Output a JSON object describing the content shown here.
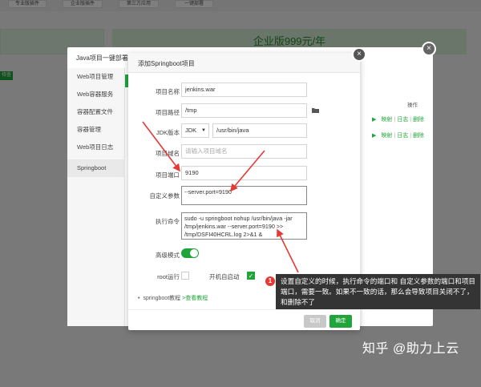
{
  "background": {
    "tabs": [
      "专业版插件",
      "企业版插件",
      "第三方应用",
      "一键部署"
    ],
    "price_banner": "企业版999元/年",
    "badge": "待查"
  },
  "back_modal": {
    "title": "Java项目一键部署",
    "nav": [
      "Web项目管理",
      "Web容器服务",
      "容器配置文件",
      "容器管理",
      "Web项目日志",
      "Springboot"
    ],
    "table_header": "操作",
    "rows": [
      {
        "play": "▶",
        "a": "映射",
        "b": "日志",
        "c": "删除"
      },
      {
        "play": "▶",
        "a": "映射",
        "b": "日志",
        "c": "删除"
      }
    ]
  },
  "dialog": {
    "title": "添加Springboot项目",
    "close_glyph": "×",
    "fields": {
      "project_name": {
        "label": "项目名称",
        "value": "jenkins.war"
      },
      "project_path": {
        "label": "项目路径",
        "value": "/tmp"
      },
      "jdk": {
        "label": "JDK版本",
        "select": "JDK",
        "value": "/usr/bin/java"
      },
      "project_domain": {
        "label": "项目域名",
        "placeholder": "请输入项目域名"
      },
      "project_port": {
        "label": "项目端口",
        "value": "9190"
      },
      "custom_params": {
        "label": "自定义参数",
        "value": "--server.port=9190"
      },
      "exec_command": {
        "label": "执行命令",
        "value": "sudo -u springboot nohup /usr/bin/java -jar /tmp/jenkins.war --server.port=9190 >> /tmp/DSFI40HCRL.log 2>&1 &"
      },
      "advanced_mode": {
        "label": "高级模式",
        "on": true
      },
      "root_run": {
        "label": "root运行",
        "checked": false
      },
      "autostart": {
        "label": "开机自启动",
        "checked": true
      }
    },
    "tutorial": {
      "prefix": "springboot教程",
      "link": ">查看教程"
    },
    "buttons": {
      "cancel": "取消",
      "ok": "确定"
    }
  },
  "annotation": {
    "number": "1",
    "text": "设置自定义的时候，执行命令的端口和 自定义参数的端口和项目端口，需要一致。如果不一致的话，那么会导致项目关闭不了，和删除不了"
  },
  "watermark": "知乎 @助力上云",
  "colors": {
    "accent": "#20a53a",
    "annotation_bg": "#343434",
    "arrow": "#e53935"
  }
}
